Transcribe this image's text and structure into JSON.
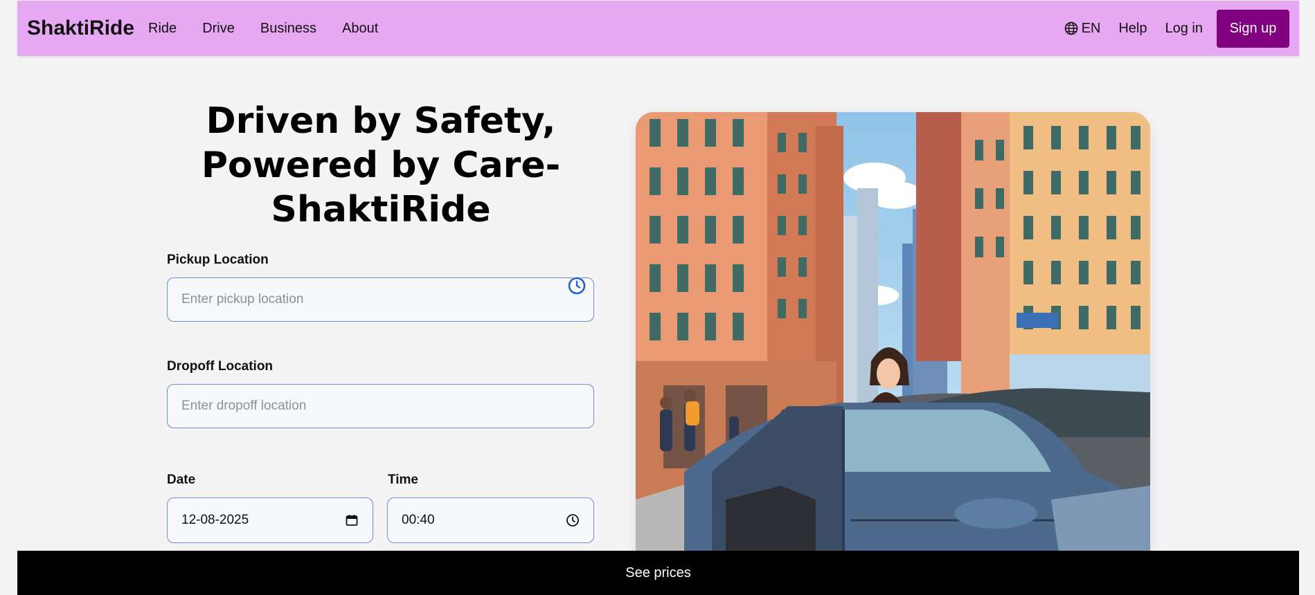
{
  "nav": {
    "brand": "ShaktiRide",
    "links": [
      "Ride",
      "Drive",
      "Business",
      "About"
    ],
    "language": "EN",
    "help": "Help",
    "login": "Log in",
    "signup": "Sign up"
  },
  "hero": {
    "title_line1": "Driven by Safety,",
    "title_line2": "Powered by Care-",
    "title_line3": "ShaktiRide"
  },
  "form": {
    "pickup_label": "Pickup Location",
    "pickup_placeholder": "Enter pickup location",
    "dropoff_label": "Dropoff Location",
    "dropoff_placeholder": "Enter dropoff location",
    "date_label": "Date",
    "date_value": "12-08-2025",
    "time_label": "Time",
    "time_value": "00:40"
  },
  "footer": {
    "see_prices": "See prices"
  },
  "colors": {
    "nav_bg": "#e7a8f3",
    "signup_bg": "#800080",
    "input_border": "#6a8fd6",
    "bottom_bar": "#000000"
  },
  "icons": {
    "language": "globe-icon",
    "pickup_recent": "clock-icon",
    "date": "calendar-icon",
    "time": "clock-icon"
  }
}
